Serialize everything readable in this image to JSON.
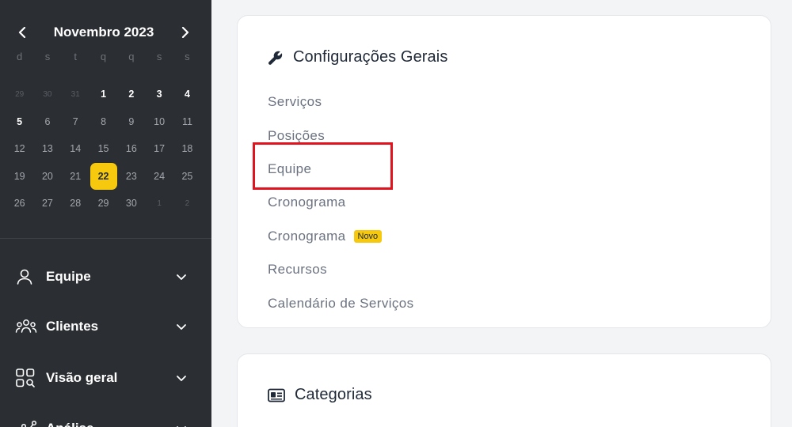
{
  "calendar": {
    "title": "Novembro 2023",
    "weekdays": [
      "d",
      "s",
      "t",
      "q",
      "q",
      "s",
      "s"
    ],
    "weeks": [
      [
        "29",
        "30",
        "31",
        "1",
        "2",
        "3",
        "4"
      ],
      [
        "5",
        "6",
        "7",
        "8",
        "9",
        "10",
        "11"
      ],
      [
        "12",
        "13",
        "14",
        "15",
        "16",
        "17",
        "18"
      ],
      [
        "19",
        "20",
        "21",
        "22",
        "23",
        "24",
        "25"
      ],
      [
        "26",
        "27",
        "28",
        "29",
        "30",
        "1",
        "2"
      ]
    ],
    "selected_day": "22"
  },
  "sidebar": {
    "items": [
      {
        "label": "Equipe",
        "icon": "user-icon"
      },
      {
        "label": "Clientes",
        "icon": "users-icon"
      },
      {
        "label": "Visão geral",
        "icon": "dashboard-icon"
      },
      {
        "label": "Análise",
        "icon": "analytics-icon"
      }
    ]
  },
  "settings_card": {
    "title": "Configurações Gerais",
    "icon": "wrench-icon",
    "links": [
      {
        "label": "Serviços"
      },
      {
        "label": "Posições"
      },
      {
        "label": "Equipe"
      },
      {
        "label": "Cronograma"
      },
      {
        "label": "Cronograma",
        "badge": "Novo"
      },
      {
        "label": "Recursos"
      },
      {
        "label": "Calendário de Serviços"
      }
    ]
  },
  "categories_card": {
    "title": "Categorias",
    "icon": "id-card-icon"
  },
  "colors": {
    "sidebar_bg": "#2b2e33",
    "accent": "#f6c90e",
    "highlight": "#e0141e"
  }
}
